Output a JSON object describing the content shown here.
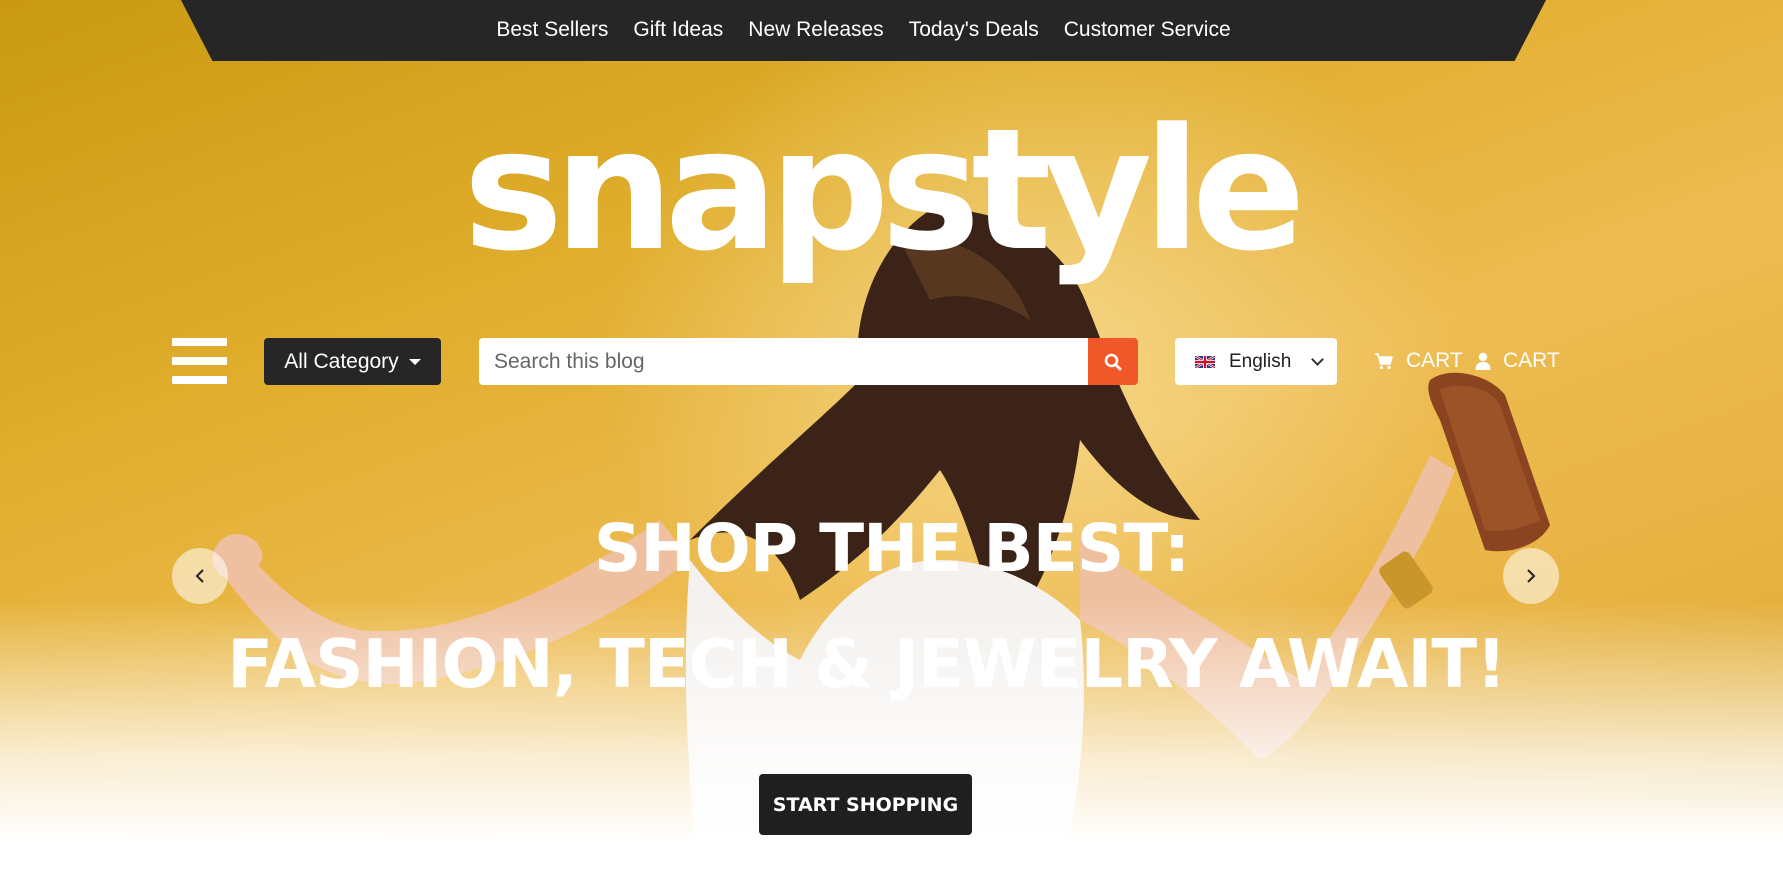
{
  "top_nav": {
    "items": [
      {
        "label": "Best Sellers"
      },
      {
        "label": "Gift Ideas"
      },
      {
        "label": "New Releases"
      },
      {
        "label": "Today's Deals"
      },
      {
        "label": "Customer Service"
      }
    ]
  },
  "logo": {
    "text": "snapstyle"
  },
  "toolbar": {
    "menu_icon": "hamburger-menu-icon",
    "category_label": "All Category",
    "search_placeholder": "Search this blog",
    "search_icon": "search-icon",
    "language_label": "English",
    "language_flag_icon": "uk-flag-icon",
    "cart_label": "CART",
    "cart_icon": "shopping-cart-icon",
    "account_label": "CART",
    "account_icon": "user-icon"
  },
  "hero": {
    "headline_1": "SHOP THE BEST:",
    "headline_2": "FASHION, TECH & JEWELRY AWAIT!",
    "cta_label": "START SHOPPING",
    "prev_icon": "chevron-left-icon",
    "next_icon": "chevron-right-icon"
  },
  "colors": {
    "background": "#E5B035",
    "nav_dark": "#262626",
    "accent": "#F0582A",
    "text_light": "#FFFFFF"
  }
}
